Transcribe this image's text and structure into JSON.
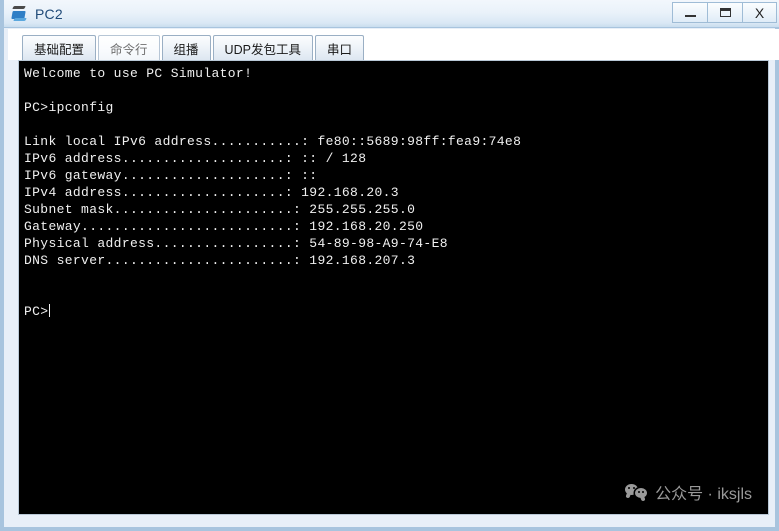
{
  "window": {
    "title": "PC2",
    "icon": "pc-device-icon",
    "controls": {
      "minimize": "_",
      "maximize": "▭",
      "close": "X"
    }
  },
  "tabs": [
    {
      "label": "基础配置",
      "active": false,
      "name": "tab-basic-config"
    },
    {
      "label": "命令行",
      "active": true,
      "name": "tab-command-line"
    },
    {
      "label": "组播",
      "active": false,
      "name": "tab-multicast"
    },
    {
      "label": "UDP发包工具",
      "active": false,
      "name": "tab-udp-packet-tool"
    },
    {
      "label": "串口",
      "active": false,
      "name": "tab-serial-port"
    }
  ],
  "terminal": {
    "lines": [
      "Welcome to use PC Simulator!",
      "",
      "PC>ipconfig",
      "",
      "Link local IPv6 address...........: fe80::5689:98ff:fea9:74e8",
      "IPv6 address....................: :: / 128",
      "IPv6 gateway....................: ::",
      "IPv4 address....................: 192.168.20.3",
      "Subnet mask......................: 255.255.255.0",
      "Gateway..........................: 192.168.20.250",
      "Physical address.................: 54-89-98-A9-74-E8",
      "DNS server.......................: 192.168.207.3",
      "",
      ""
    ],
    "prompt": "PC>",
    "command_value": "",
    "cursor_visible": true,
    "fields": [
      {
        "label": "Link local IPv6 address",
        "value": "fe80::5689:98ff:fea9:74e8"
      },
      {
        "label": "IPv6 address",
        "value": ":: / 128"
      },
      {
        "label": "IPv6 gateway",
        "value": "::"
      },
      {
        "label": "IPv4 address",
        "value": "192.168.20.3"
      },
      {
        "label": "Subnet mask",
        "value": "255.255.255.0"
      },
      {
        "label": "Gateway",
        "value": "192.168.20.250"
      },
      {
        "label": "Physical address",
        "value": "54-89-98-A9-74-E8"
      },
      {
        "label": "DNS server",
        "value": "192.168.207.3"
      }
    ],
    "background_color": "#000000",
    "text_color": "#f0f0f0"
  },
  "watermark": {
    "icon": "wechat-icon",
    "text": "公众号 · iksjls"
  }
}
